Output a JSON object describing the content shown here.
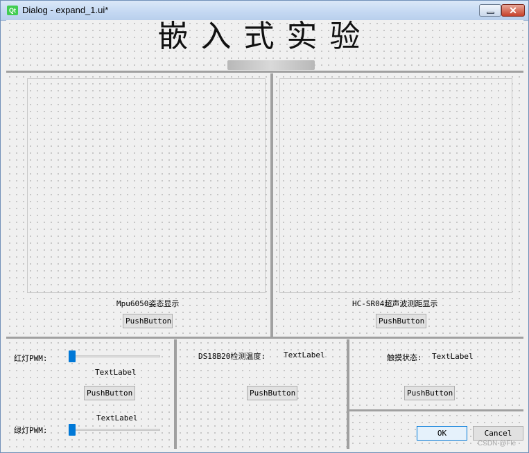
{
  "window": {
    "logo": "Qt",
    "title": "Dialog - expand_1.ui*",
    "close_glyph": "✕"
  },
  "header": {
    "title": "嵌入式实验"
  },
  "panels": {
    "mpu": {
      "caption": "Mpu6050姿态显示",
      "button": "PushButton"
    },
    "hcsr": {
      "caption": "HC-SR04超声波测距显示",
      "button": "PushButton"
    }
  },
  "pwm": {
    "red_label": "红灯PWM:",
    "red_text": "TextLabel",
    "button": "PushButton",
    "green_text": "TextLabel",
    "green_label": "绿灯PWM:",
    "red_value": 0,
    "green_value": 0
  },
  "temp": {
    "label": "DS18B20检测温度:",
    "value": "TextLabel",
    "button": "PushButton"
  },
  "touch": {
    "label": "触摸状态:",
    "value": "TextLabel",
    "button": "PushButton"
  },
  "dialog": {
    "ok": "OK",
    "cancel": "Cancel"
  },
  "watermark": "CSDN @Fle",
  "colors": {
    "slider_handle": "#0078d7",
    "separator": "#a0a0a0",
    "qt_green": "#41cd52"
  }
}
